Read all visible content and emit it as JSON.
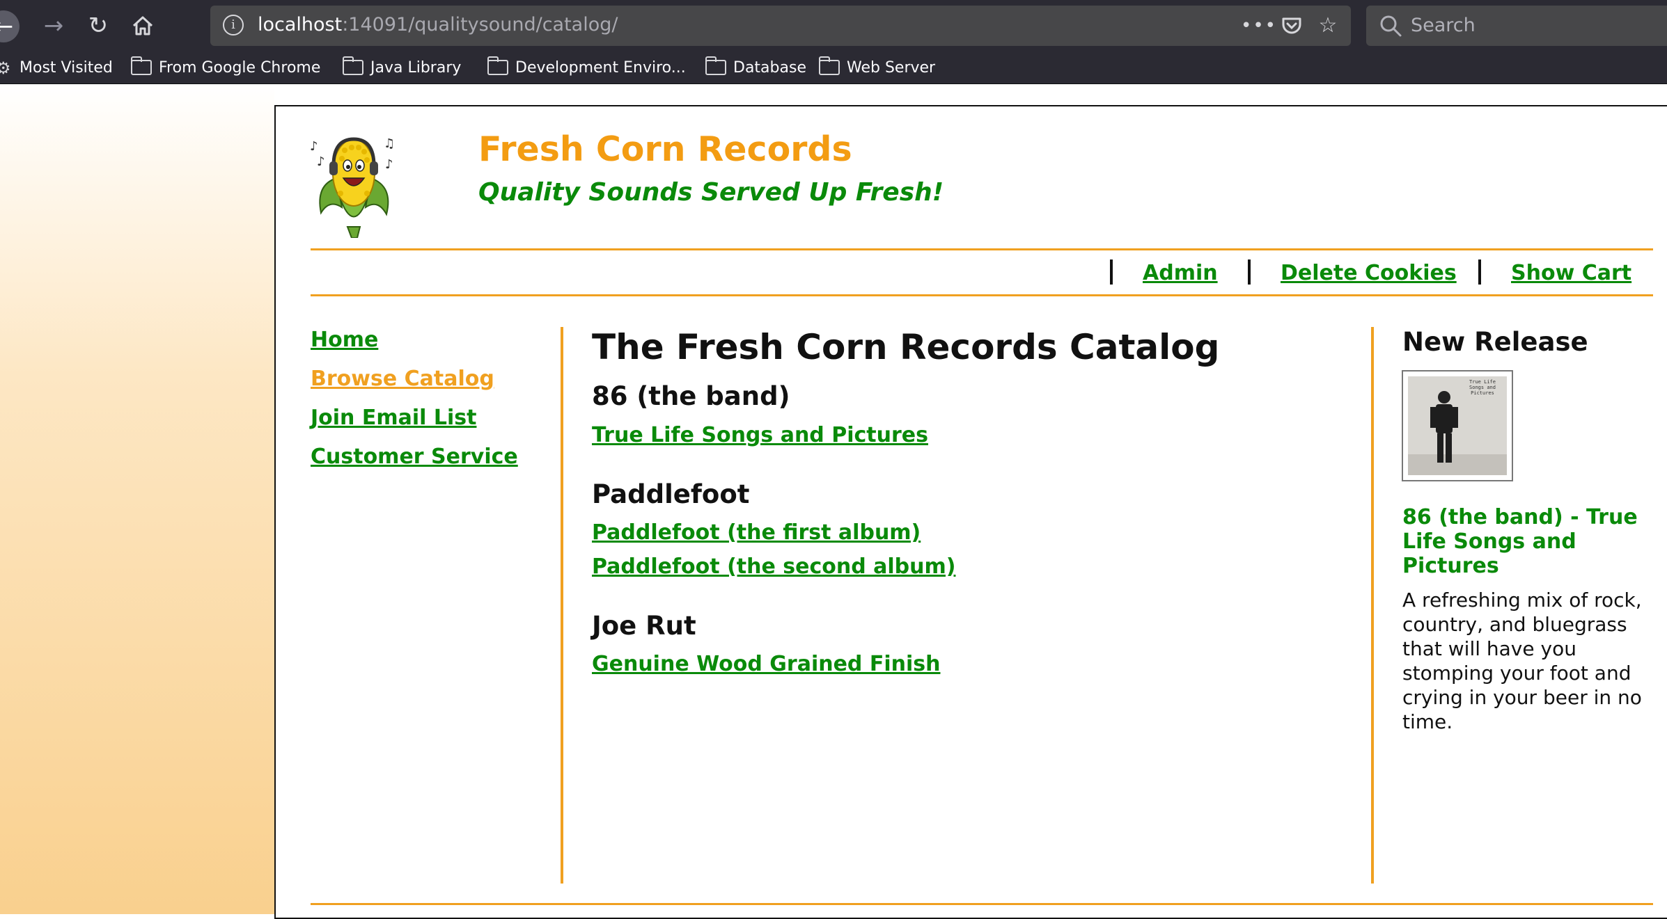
{
  "browser": {
    "url_host": "localhost",
    "url_path": ":14091/qualitysound/catalog/",
    "search_placeholder": "Search",
    "bookmarks": [
      "Most Visited",
      "From Google Chrome",
      "Java Library",
      "Development Enviro...",
      "Database",
      "Web Server"
    ]
  },
  "header": {
    "site_title": "Fresh Corn Records",
    "tagline": "Quality Sounds Served Up Fresh!"
  },
  "top_nav": {
    "admin": "Admin",
    "delete_cookies": "Delete Cookies",
    "show_cart": "Show Cart"
  },
  "sidebar": {
    "items": [
      {
        "label": "Home",
        "active": false
      },
      {
        "label": "Browse Catalog",
        "active": true
      },
      {
        "label": "Join Email List",
        "active": false
      },
      {
        "label": "Customer Service",
        "active": false
      }
    ]
  },
  "catalog": {
    "title": "The Fresh Corn Records Catalog",
    "artists": [
      {
        "name": "86 (the band)",
        "albums": [
          "True Life Songs and Pictures"
        ]
      },
      {
        "name": "Paddlefoot",
        "albums": [
          "Paddlefoot (the first album)",
          "Paddlefoot (the second album)"
        ]
      },
      {
        "name": "Joe Rut",
        "albums": [
          "Genuine Wood Grained Finish"
        ]
      }
    ]
  },
  "new_release": {
    "heading": "New Release",
    "cover_text": "True Life Songs and Pictures",
    "title": "86 (the band) - True Life Songs and Pictures",
    "description": "A refreshing mix of rock, country, and bluegrass that will have you stomping your foot and crying in your beer in no time."
  },
  "colors": {
    "brand_orange": "#f39c12",
    "link_green": "#0a8a0a",
    "rule_orange": "#f0a020"
  }
}
